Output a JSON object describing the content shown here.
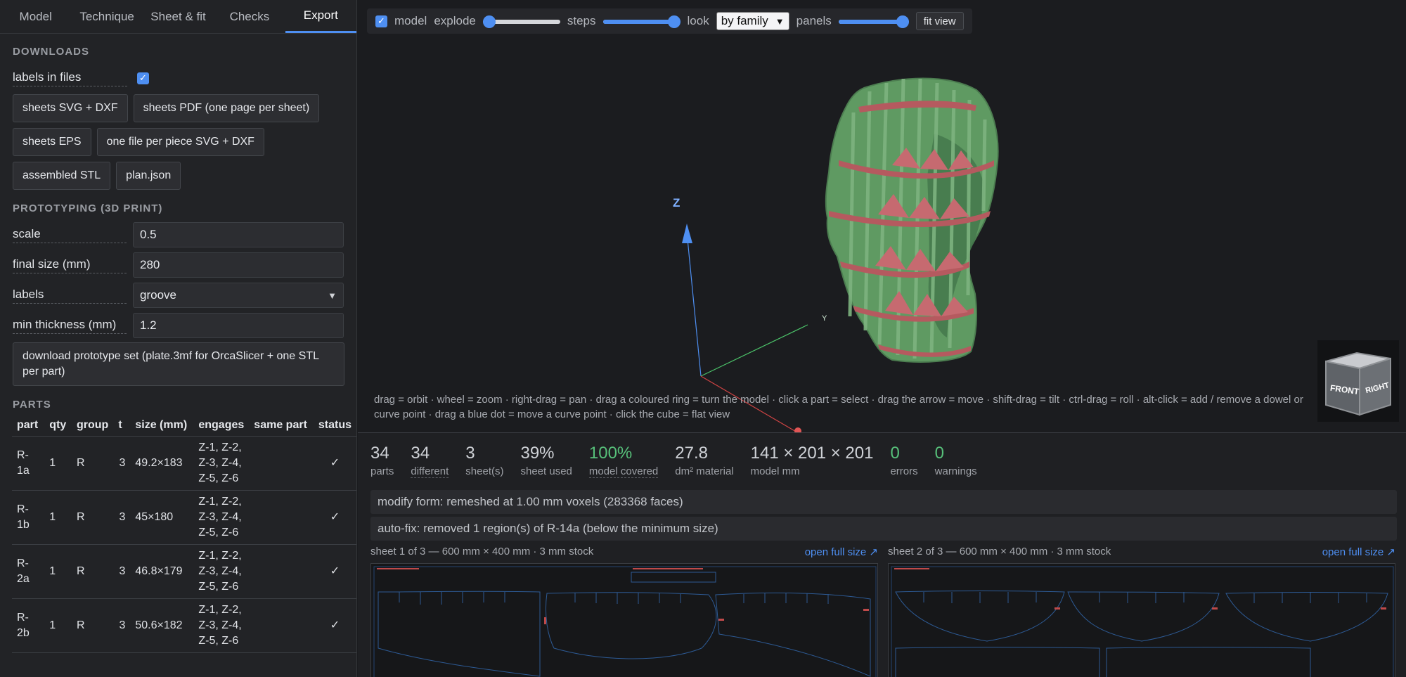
{
  "tabs": [
    {
      "label": "Model"
    },
    {
      "label": "Technique"
    },
    {
      "label": "Sheet & fit"
    },
    {
      "label": "Checks"
    },
    {
      "label": "Export"
    }
  ],
  "downloads": {
    "title": "DOWNLOADS",
    "labels_in_files": "labels in files",
    "buttons": [
      "sheets SVG + DXF",
      "sheets PDF (one page per sheet)",
      "sheets EPS",
      "one file per piece SVG + DXF",
      "assembled STL",
      "plan.json"
    ]
  },
  "prototyping": {
    "title": "PROTOTYPING (3D PRINT)",
    "fields": [
      {
        "label": "scale",
        "value": "0.5"
      },
      {
        "label": "final size (mm)",
        "value": "280"
      },
      {
        "label": "labels",
        "value": "groove"
      },
      {
        "label": "min thickness (mm)",
        "value": "1.2"
      }
    ],
    "download_button": "download prototype set (plate.3mf for OrcaSlicer + one STL per part)"
  },
  "parts": {
    "title": "PARTS",
    "columns": [
      "part",
      "qty",
      "group",
      "t",
      "size (mm)",
      "engages",
      "same part",
      "status"
    ],
    "rows": [
      {
        "part": "R-1a",
        "qty": "1",
        "group": "R",
        "t": "3",
        "size": "49.2×183",
        "engages": "Z-1, Z-2, Z-3, Z-4, Z-5, Z-6",
        "same": "",
        "status": "✓"
      },
      {
        "part": "R-1b",
        "qty": "1",
        "group": "R",
        "t": "3",
        "size": "45×180",
        "engages": "Z-1, Z-2, Z-3, Z-4, Z-5, Z-6",
        "same": "",
        "status": "✓"
      },
      {
        "part": "R-2a",
        "qty": "1",
        "group": "R",
        "t": "3",
        "size": "46.8×179",
        "engages": "Z-1, Z-2, Z-3, Z-4, Z-5, Z-6",
        "same": "",
        "status": "✓"
      },
      {
        "part": "R-2b",
        "qty": "1",
        "group": "R",
        "t": "3",
        "size": "50.6×182",
        "engages": "Z-1, Z-2, Z-3, Z-4, Z-5, Z-6",
        "same": "",
        "status": "✓"
      }
    ]
  },
  "toolbar": {
    "model": "model",
    "explode": "explode",
    "explode_level": 0,
    "steps": "steps",
    "steps_level": 1,
    "look": "look",
    "look_value": "by family",
    "panels": "panels",
    "panels_level": 1,
    "fit_view": "fit view"
  },
  "scene": {
    "axis_z": "Z",
    "axis_y": "Y",
    "cube_front": "FRONT",
    "cube_right": "RIGHT",
    "model_color": "#5f9a62",
    "ring_color": "#b55a5f"
  },
  "hint": "drag = orbit · wheel = zoom · right-drag = pan · drag a coloured ring = turn the model · click a part = select · drag the arrow = move · shift-drag = tilt · ctrl-drag = roll · alt-click = add / remove a dowel or curve point · drag a blue dot = move a curve point · click the cube = flat view",
  "stats": [
    {
      "value": "34",
      "caption": "parts",
      "ok": false,
      "dotted": false
    },
    {
      "value": "34",
      "caption": "different",
      "ok": false,
      "dotted": true
    },
    {
      "value": "3",
      "caption": "sheet(s)",
      "ok": false,
      "dotted": false
    },
    {
      "value": "39%",
      "caption": "sheet used",
      "ok": false,
      "dotted": false
    },
    {
      "value": "100%",
      "caption": "model covered",
      "ok": true,
      "dotted": true
    },
    {
      "value": "27.8",
      "caption": "dm² material",
      "ok": false,
      "dotted": false
    },
    {
      "value": "141 × 201 × 201",
      "caption": "model mm",
      "ok": false,
      "dotted": false
    },
    {
      "value": "0",
      "caption": "errors",
      "ok": true,
      "dotted": false
    },
    {
      "value": "0",
      "caption": "warnings",
      "ok": true,
      "dotted": false
    }
  ],
  "notices": [
    "modify form: remeshed at 1.00 mm voxels (283368 faces)",
    "auto-fix: removed 1 region(s) of R-14a (below the minimum size)"
  ],
  "sheets": [
    {
      "title": "sheet 1 of 3 — 600 mm × 400 mm · 3 mm stock",
      "link": "open full size ↗"
    },
    {
      "title": "sheet 2 of 3 — 600 mm × 400 mm · 3 mm stock",
      "link": "open full size ↗"
    }
  ]
}
